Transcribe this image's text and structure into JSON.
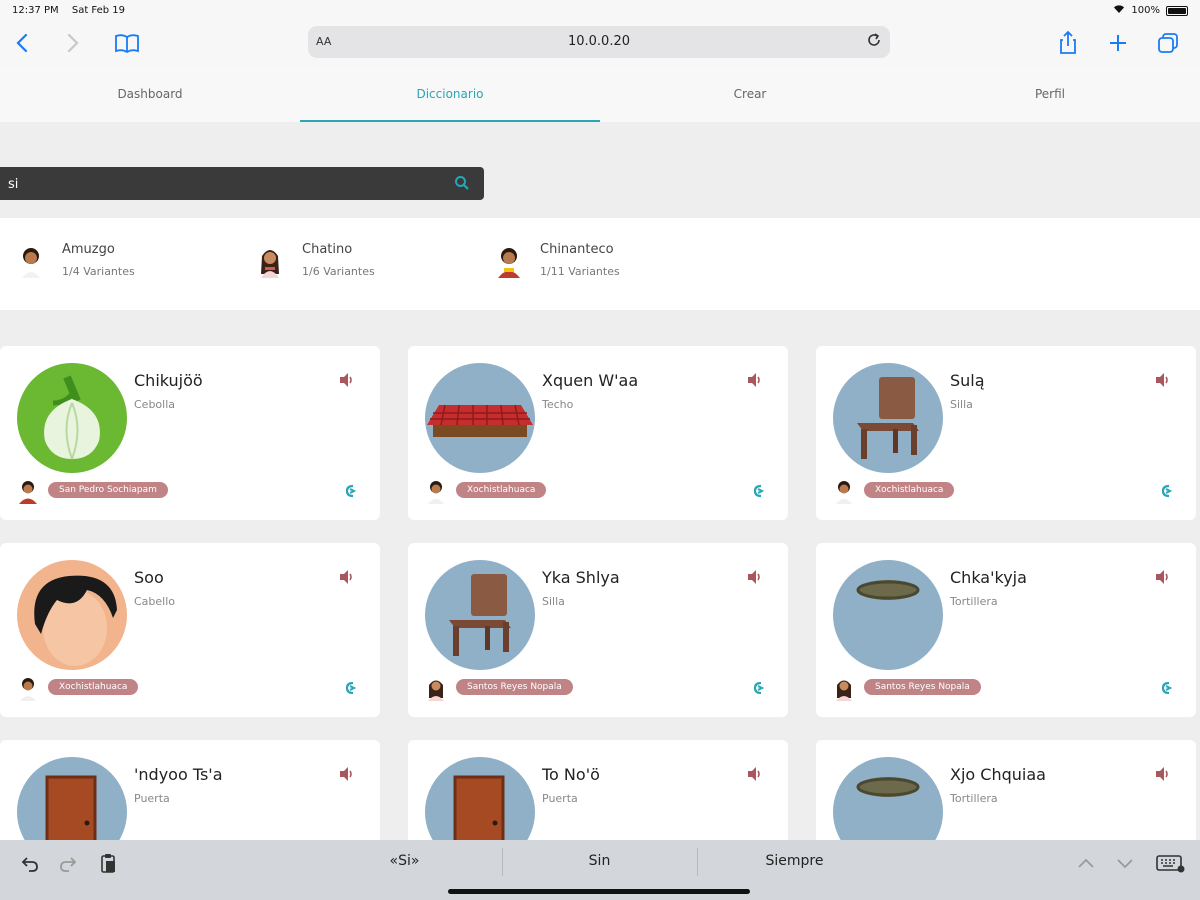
{
  "status": {
    "time": "12:37 PM",
    "date": "Sat Feb 19",
    "battery": "100%"
  },
  "browser": {
    "aa_label": "AA",
    "url": "10.0.0.20"
  },
  "tabs": [
    {
      "label": "Dashboard"
    },
    {
      "label": "Diccionario"
    },
    {
      "label": "Crear"
    },
    {
      "label": "Perfil"
    }
  ],
  "search": {
    "value": "si"
  },
  "languages": [
    {
      "name": "Amuzgo",
      "variants": "1/4 Variantes"
    },
    {
      "name": "Chatino",
      "variants": "1/6 Variantes"
    },
    {
      "name": "Chinanteco",
      "variants": "1/11 Variantes"
    }
  ],
  "cards": [
    {
      "word": "Chikujöö",
      "translation": "Cebolla",
      "badge": "San Pedro Sochiapam",
      "image": "onion"
    },
    {
      "word": "Xquen W'aa",
      "translation": "Techo",
      "badge": "Xochistlahuaca",
      "image": "roof"
    },
    {
      "word": "Sulą",
      "translation": "Silla",
      "badge": "Xochistlahuaca",
      "image": "chair"
    },
    {
      "word": "Soo",
      "translation": "Cabello",
      "badge": "Xochistlahuaca",
      "image": "hair"
    },
    {
      "word": "Yka Shlya",
      "translation": "Silla",
      "badge": "Santos Reyes Nopala",
      "image": "chair"
    },
    {
      "word": "Chka'kyja",
      "translation": "Tortillera",
      "badge": "Santos Reyes Nopala",
      "image": "basket"
    },
    {
      "word": "'ndyoo Ts'a",
      "translation": "Puerta",
      "badge": "",
      "image": "door"
    },
    {
      "word": "To No'ö",
      "translation": "Puerta",
      "badge": "",
      "image": "door"
    },
    {
      "word": "Xjo Chquiaa",
      "translation": "Tortillera",
      "badge": "",
      "image": "basket"
    }
  ],
  "keyboard": {
    "suggestions": [
      "«Si»",
      "Sin",
      "Siempre"
    ]
  },
  "colors": {
    "accent": "#2aa5b5",
    "badge": "#c08486",
    "speaker": "#a8585c",
    "search_bg": "#3a3a3a"
  }
}
